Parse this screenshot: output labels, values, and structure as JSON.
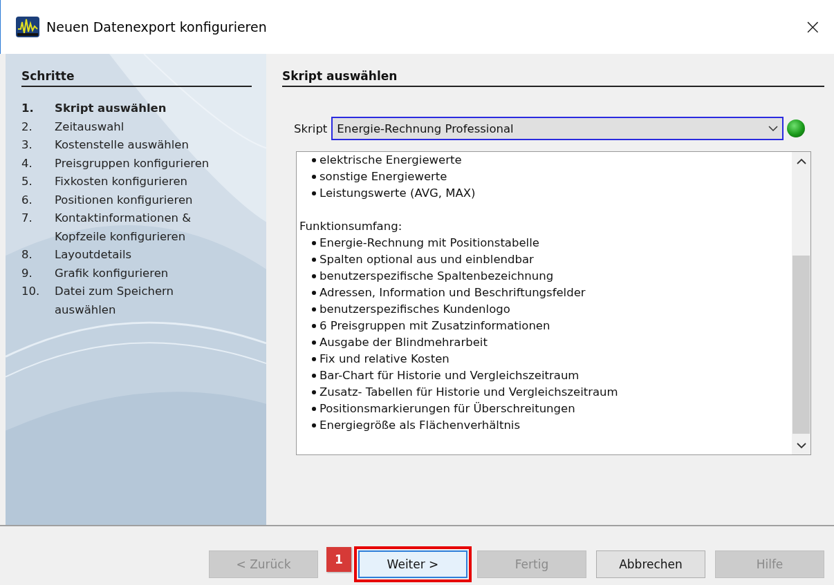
{
  "window": {
    "title": "Neuen Datenexport konfigurieren",
    "close": "×"
  },
  "steps": {
    "title": "Schritte",
    "items": [
      {
        "number": "1.",
        "label": "Skript auswählen",
        "selected": true
      },
      {
        "number": "2.",
        "label": "Zeitauswahl",
        "selected": false
      },
      {
        "number": "3.",
        "label": "Kostenstelle auswählen",
        "selected": false
      },
      {
        "number": "4.",
        "label": "Preisgruppen konfigurieren",
        "selected": false
      },
      {
        "number": "5.",
        "label": "Fixkosten konfigurieren",
        "selected": false
      },
      {
        "number": "6.",
        "label": "Positionen konfigurieren",
        "selected": false
      },
      {
        "number": "7.",
        "label": "Kontaktinformationen & Kopfzeile konfigurieren",
        "selected": false
      },
      {
        "number": "8.",
        "label": "Layoutdetails",
        "selected": false
      },
      {
        "number": "9.",
        "label": "Grafik konfigurieren",
        "selected": false
      },
      {
        "number": "10.",
        "label": "Datei zum Speichern auswählen",
        "selected": false
      }
    ]
  },
  "page": {
    "title": "Skript auswählen",
    "script_label": "Skript",
    "script_value": "Energie-Rechnung Professional",
    "valid": true,
    "description": [
      {
        "items": [
          "elektrische Energiewerte",
          "sonstige Energiewerte",
          "Leistungswerte (AVG, MAX)"
        ]
      },
      {
        "heading": "Funktionsumfang:",
        "items": [
          "Energie-Rechnung mit Positionstabelle",
          "Spalten optional aus und einblendbar",
          "benutzerspezifische Spaltenbezeichnung",
          "Adressen, Information und Beschriftungsfelder",
          "benutzerspezifisches Kundenlogo",
          "6 Preisgruppen mit Zusatzinformationen",
          "Ausgabe der Blindmehrarbeit",
          "Fix und relative Kosten",
          "Bar-Chart für Historie und Vergleichszeitraum",
          "Zusatz- Tabellen für Historie und Vergleichszeitraum",
          "Positionsmarkierungen für Überschreitungen",
          "Energiegröße als Flächenverhältnis"
        ]
      }
    ]
  },
  "buttons": [
    {
      "label": "< Zurück",
      "disabled": true,
      "highlighted": false
    },
    {
      "label": "Weiter >",
      "disabled": false,
      "highlighted": true
    },
    {
      "label": "Fertig",
      "disabled": true,
      "highlighted": false
    },
    {
      "label": "Abbrechen",
      "disabled": false,
      "highlighted": false
    },
    {
      "label": "Hilfe",
      "disabled": true,
      "highlighted": false
    }
  ],
  "callout": {
    "label": "1"
  }
}
